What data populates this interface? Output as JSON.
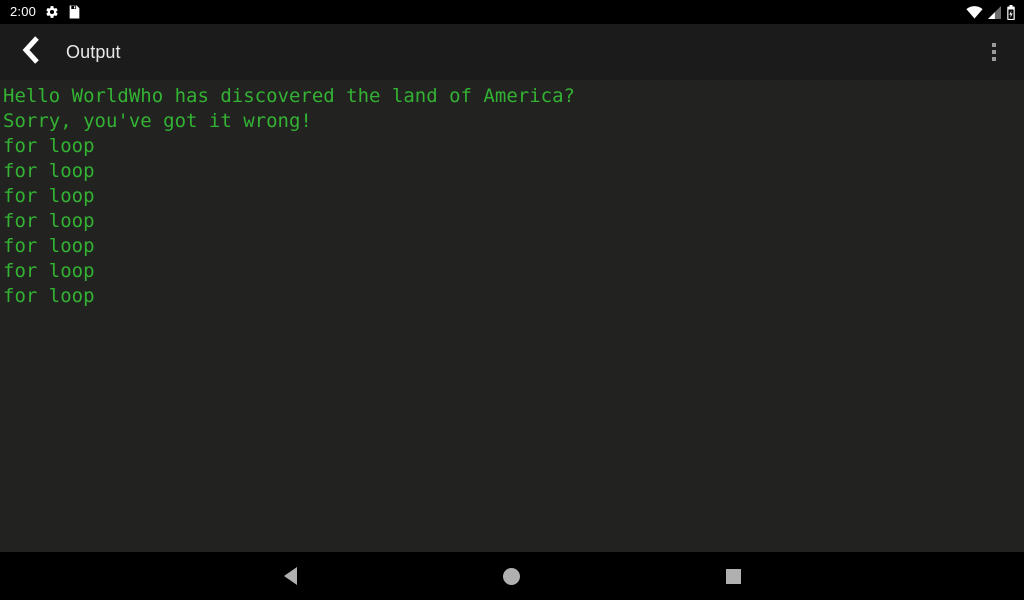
{
  "status_bar": {
    "clock": "2:00",
    "left_icons": [
      {
        "name": "settings-gear-icon",
        "label": "gear-icon"
      },
      {
        "name": "file-save-icon",
        "label": "document-icon"
      }
    ],
    "right_icons": [
      {
        "name": "wifi-icon",
        "label": "wifi-icon"
      },
      {
        "name": "cellular-signal-icon",
        "label": "signal-icon"
      },
      {
        "name": "battery-icon",
        "label": "battery-icon"
      }
    ]
  },
  "app_bar": {
    "back_label": "back-icon",
    "title": "Output",
    "overflow_label": "more-options-icon"
  },
  "console": {
    "text_color": "#33b233",
    "background_color": "#222220",
    "lines": [
      "Hello WorldWho has discovered the land of America?",
      "Sorry, you've got it wrong!",
      "for loop",
      "for loop",
      "for loop",
      "for loop",
      "for loop",
      "for loop",
      "for loop"
    ]
  },
  "nav_bar": {
    "back_label": "nav-back",
    "home_label": "nav-home",
    "recents_label": "nav-recents"
  }
}
